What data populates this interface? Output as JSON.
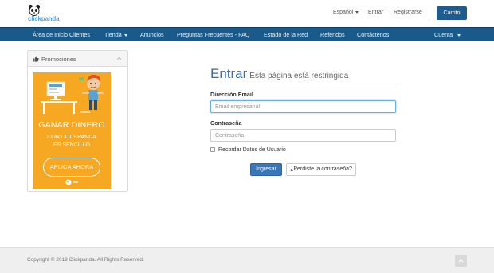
{
  "header": {
    "brand_text": "clickpanda",
    "language_label": "Español",
    "login_label": "Entrar",
    "register_label": "Registrarse",
    "cart_label": "Carrito"
  },
  "nav": {
    "items": [
      {
        "label": "Área de Inicio Clientes"
      },
      {
        "label": "Tienda",
        "dropdown": true
      },
      {
        "label": "Anuncios"
      },
      {
        "label": "Preguntas Frecuentes - FAQ"
      },
      {
        "label": "Estado de la Red"
      },
      {
        "label": "Referidos"
      },
      {
        "label": "Contáctenos"
      }
    ],
    "account_label": "Cuenta"
  },
  "sidebar": {
    "panel_title": "Promociones",
    "panel_icon": "thumbs-up-icon",
    "ad": {
      "line1": "GANAR DINERO",
      "line2": "CON CLICKPANDA",
      "line3": "ES SENCILLO",
      "button": "APLICA AHORA"
    }
  },
  "login": {
    "title": "Entrar",
    "subtitle": "Esta página está restringida",
    "email_label": "Dirección Email",
    "email_placeholder": "Email empresarial",
    "password_label": "Contraseña",
    "password_placeholder": "Contraseña",
    "remember_label": "Recordar Datos de Usuario",
    "submit_label": "Ingresar",
    "forgot_label": "¿Perdiste la contraseña?"
  },
  "footer": {
    "copyright": "Copyright © 2019 Clickpanda. All Rights Reserved."
  },
  "colors": {
    "nav_bg": "#1a5a8a",
    "cart_btn": "#1f5b8c",
    "accent_blue": "#3a6ea5",
    "ad_orange": "#f7a823"
  }
}
